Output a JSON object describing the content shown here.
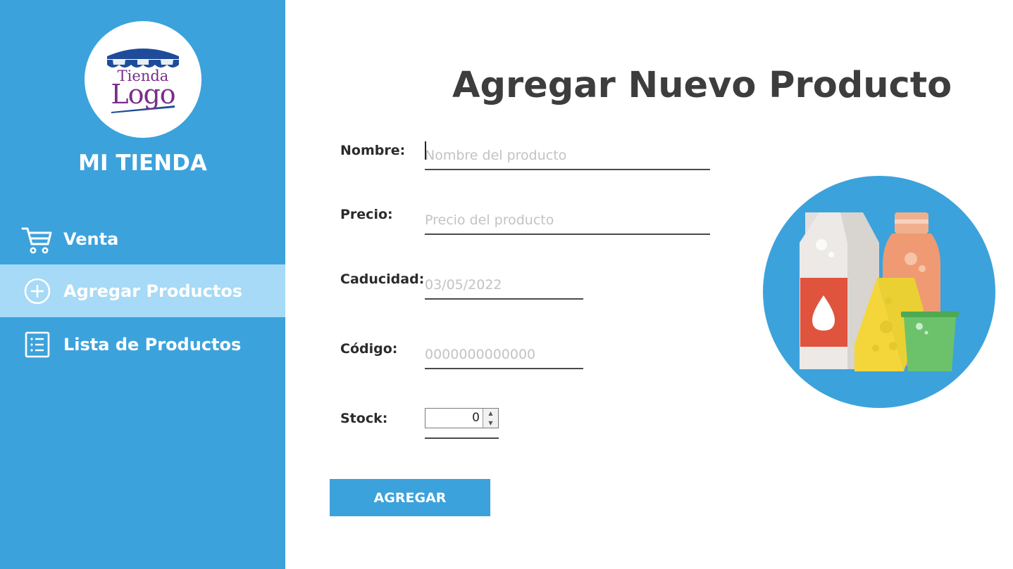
{
  "sidebar": {
    "logo": {
      "line1": "Tienda",
      "line2": "Logo"
    },
    "brand": "MI TIENDA",
    "items": [
      {
        "label": "Venta",
        "icon": "cart-icon"
      },
      {
        "label": "Agregar Productos",
        "icon": "plus-circle-icon",
        "active": true
      },
      {
        "label": "Lista de Productos",
        "icon": "list-icon"
      }
    ]
  },
  "main": {
    "title": "Agregar Nuevo Producto",
    "fields": {
      "nombre": {
        "label": "Nombre:",
        "placeholder": "Nombre del producto",
        "value": ""
      },
      "precio": {
        "label": "Precio:",
        "placeholder": "Precio del producto",
        "value": ""
      },
      "caducidad": {
        "label": "Caducidad:",
        "placeholder": "03/05/2022",
        "value": ""
      },
      "codigo": {
        "label": "Código:",
        "placeholder": "0000000000000",
        "value": ""
      },
      "stock": {
        "label": "Stock:",
        "value": "0"
      }
    },
    "submit_label": "AGREGAR",
    "illustration": "groceries-illustration"
  },
  "colors": {
    "sidebar": "#3ca2dc",
    "active_item": "#a6daf6",
    "button": "#3ca2dc",
    "title": "#3d3d3d"
  }
}
